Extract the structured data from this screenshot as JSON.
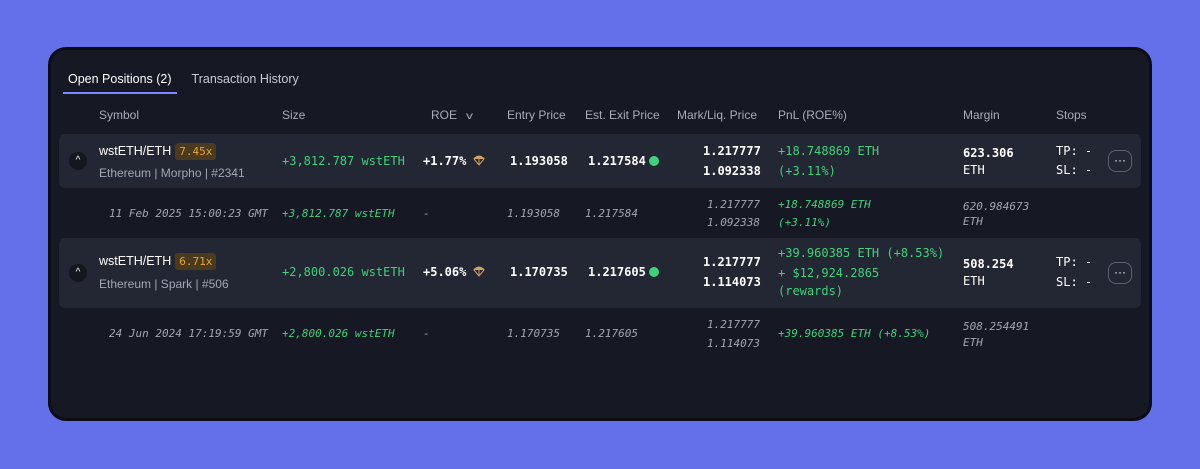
{
  "tabs": [
    {
      "label": "Open Positions (2)"
    },
    {
      "label": "Transaction History"
    }
  ],
  "columns": {
    "symbol": "Symbol",
    "size": "Size",
    "roe": "ROE",
    "entry": "Entry Price",
    "exit": "Est. Exit Price",
    "mark": "Mark/Liq. Price",
    "pnl": "PnL (ROE%)",
    "margin": "Margin",
    "stops": "Stops"
  },
  "positions": [
    {
      "symbol": "wstETH/ETH",
      "leverage": "7.45x",
      "sub": "Ethereum | Morpho | #2341",
      "size": "+3,812.787 wstETH",
      "roe": "+1.77%",
      "entry": "1.193058",
      "exit": "1.217584",
      "mark": "1.217777",
      "liq": "1.092338",
      "pnl1": "+18.748869 ETH",
      "pnl2": "(+3.11%)",
      "margin1": "623.306",
      "margin2": "ETH",
      "tp": "TP: -",
      "sl": "SL: -",
      "tx": {
        "time": "11 Feb 2025 15:00:23 GMT",
        "size": "+3,812.787 wstETH",
        "roe": "-",
        "entry": "1.193058",
        "exit": "1.217584",
        "mark": "1.217777",
        "liq": "1.092338",
        "pnl1": "+18.748869 ETH",
        "pnl2": "(+3.11%)",
        "margin1": "620.984673",
        "margin2": "ETH"
      }
    },
    {
      "symbol": "wstETH/ETH",
      "leverage": "6.71x",
      "sub": "Ethereum | Spark | #506",
      "size": "+2,800.026 wstETH",
      "roe": "+5.06%",
      "entry": "1.170735",
      "exit": "1.217605",
      "mark": "1.217777",
      "liq": "1.114073",
      "pnl1": "+39.960385 ETH (+8.53%)",
      "pnl2": "+ $12,924.2865",
      "pnl3": "(rewards)",
      "margin1": "508.254",
      "margin2": "ETH",
      "tp": "TP: -",
      "sl": "SL: -",
      "tx": {
        "time": "24 Jun 2024 17:19:59 GMT",
        "size": "+2,800.026 wstETH",
        "roe": "-",
        "entry": "1.170735",
        "exit": "1.217605",
        "mark": "1.217777",
        "liq": "1.114073",
        "pnl1": "+39.960385 ETH (+8.53%)",
        "margin1": "508.254491",
        "margin2": "ETH"
      }
    }
  ],
  "icons": {
    "expand": "chevron-up-icon",
    "more": "more-icon",
    "parachute": "parachute-icon",
    "status": "green-dot-icon"
  },
  "colors": {
    "background": "#6470ea",
    "panel": "#161823",
    "accent": "#7b88ff",
    "positive": "#3ed37a",
    "leverage": "#e8a23a"
  }
}
